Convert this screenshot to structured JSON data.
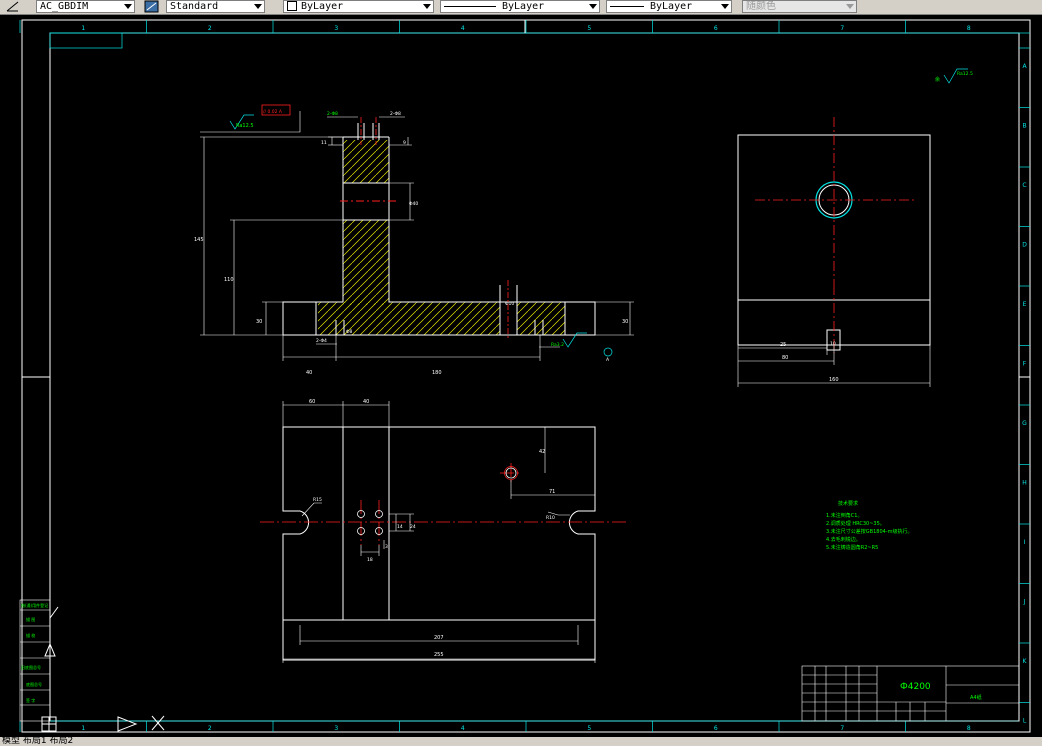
{
  "toolbar": {
    "dimstyle": "AC_GBDIM",
    "textstyle": "Standard",
    "layer_color": "ByLayer",
    "linetype": "ByLayer",
    "lineweight": "ByLayer",
    "plotstyle": "随颜色"
  },
  "border": {
    "cols": [
      "1",
      "2",
      "3",
      "4",
      "5",
      "6",
      "7",
      "8"
    ],
    "rows": [
      "A",
      "B",
      "C",
      "D",
      "E",
      "F",
      "G",
      "H",
      "I",
      "J",
      "K",
      "L"
    ]
  },
  "front_view": {
    "roughness_top": "Ra12.5",
    "tolerance_frame": "// 0.02 A",
    "dim_top_left": "2-Φ8",
    "dim_top_right": "2-Φ8",
    "dim_11": "11",
    "dim_9": "9",
    "dim_phi40": "Φ40",
    "dim_h145": "145",
    "dim_h110": "110",
    "dim_30_left": "30",
    "dim_30_right": "30",
    "dim_2phi4": "2-Φ4",
    "dim_phi8": "Φ8",
    "dim_phi10": "Φ10",
    "dim_40": "40",
    "dim_180": "180",
    "roughness_bottom": "Ra3.2",
    "datum": "A"
  },
  "side_view": {
    "dim_25": "25",
    "dim_80": "80",
    "dim_160": "160",
    "dim_10": "10"
  },
  "top_view": {
    "dim_60": "60",
    "dim_40": "40",
    "dim_42": "42",
    "dim_r15": "R15",
    "dim_71": "71",
    "dim_r10": "R10",
    "dim_14": "14",
    "dim_24": "24",
    "dim_18": "18",
    "dim_3": "3",
    "dim_207": "207",
    "dim_255": "255"
  },
  "roughness_general": "Ra12.5",
  "notes": {
    "title": "技术要求",
    "items": [
      "1.未注倒角C1。",
      "2.调质处理 HRC30~35。",
      "3.未注尺寸公差按GB1804-m级执行。",
      "4.去毛刺锐边。",
      "5.未注铸造圆角R2~R5"
    ]
  },
  "title_block": {
    "part_code": "Ф4200",
    "material": "A4纸"
  },
  "side_labels": [
    "借(通)用件登记",
    "描 图",
    "描 校",
    "旧底图总号",
    "底图总号",
    "签 字",
    "日 期"
  ],
  "status_tabs": "模型 布局1 布局2"
}
